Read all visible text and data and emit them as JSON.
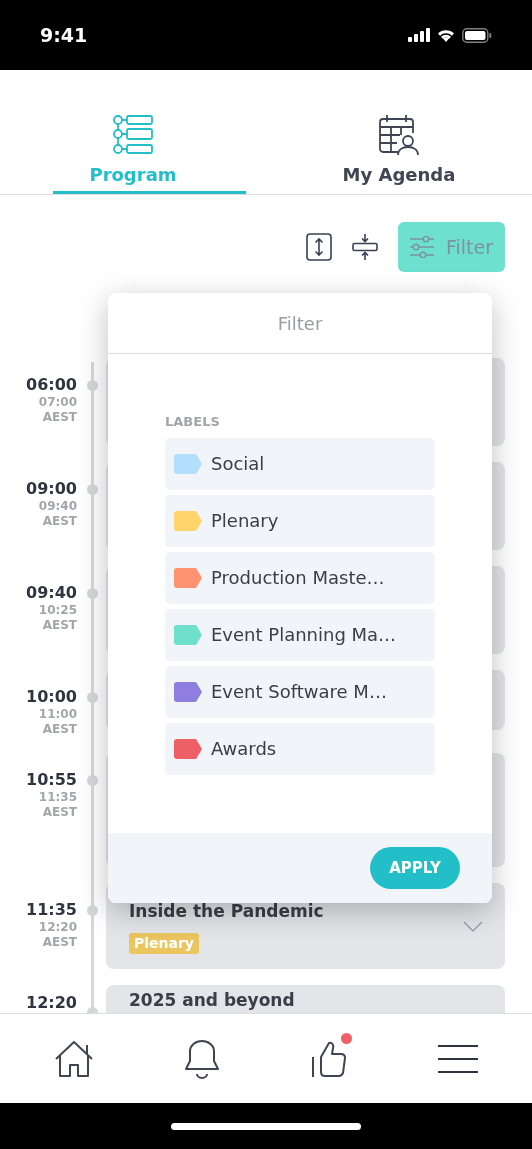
{
  "status_bar": {
    "time": "9:41"
  },
  "tabs": [
    {
      "label": "Program",
      "kind": "program",
      "selected": true
    },
    {
      "label": "My Agenda",
      "kind": "agenda",
      "selected": false
    }
  ],
  "toolbar": {
    "filter_button": "Filter"
  },
  "timeline": [
    {
      "time": "06:00",
      "local_time": "07:00",
      "timezone": "AEST"
    },
    {
      "time": "09:00",
      "local_time": "09:40",
      "timezone": "AEST"
    },
    {
      "time": "09:40",
      "local_time": "10:25",
      "timezone": "AEST"
    },
    {
      "time": "10:00",
      "local_time": "11:00",
      "timezone": "AEST"
    },
    {
      "time": "10:55",
      "local_time": "11:35",
      "timezone": "AEST"
    },
    {
      "time": "11:35",
      "local_time": "12:20",
      "timezone": "AEST",
      "title": "Inside the Pandemic",
      "tag": {
        "label": "Plenary",
        "color": "#ebc55f"
      },
      "expandable": true
    },
    {
      "time": "12:20",
      "title": "2025 and beyond"
    }
  ],
  "filter_dialog": {
    "title": "Filter",
    "section": "LABELS",
    "labels": [
      {
        "name": "Social",
        "color": "#b3defc"
      },
      {
        "name": "Plenary",
        "color": "#fed46b"
      },
      {
        "name": "Production Maste…",
        "color": "#fd9370"
      },
      {
        "name": "Event Planning Ma…",
        "color": "#6ee0cc"
      },
      {
        "name": "Event Software M…",
        "color": "#8f7ee0"
      },
      {
        "name": "Awards",
        "color": "#ef5f66"
      }
    ],
    "apply": "APPLY"
  },
  "bottom_nav": [
    {
      "kind": "home",
      "badge": false
    },
    {
      "kind": "bell",
      "badge": false
    },
    {
      "kind": "thumbs-up",
      "badge": true
    },
    {
      "kind": "menu",
      "badge": false
    }
  ]
}
